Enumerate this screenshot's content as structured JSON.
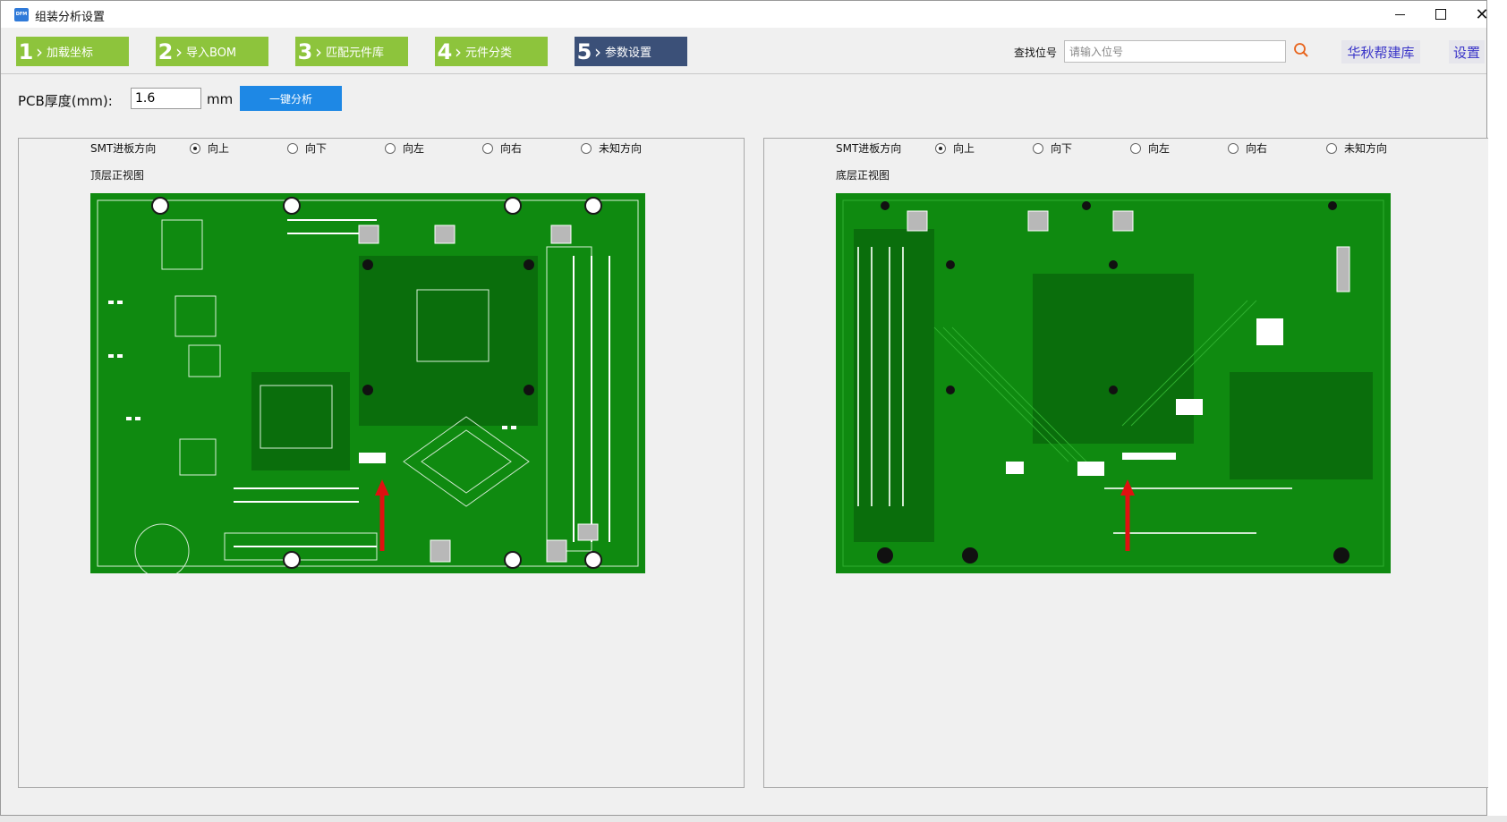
{
  "window": {
    "title": "组装分析设置",
    "app_icon_text": "DFM"
  },
  "steps": [
    {
      "num": "1",
      "label": "加载坐标",
      "state": "done"
    },
    {
      "num": "2",
      "label": "导入BOM",
      "state": "done"
    },
    {
      "num": "3",
      "label": "匹配元件库",
      "state": "done"
    },
    {
      "num": "4",
      "label": "元件分类",
      "state": "done"
    },
    {
      "num": "5",
      "label": "参数设置",
      "state": "active"
    }
  ],
  "search": {
    "label": "查找位号",
    "placeholder": "请输入位号",
    "icon": "search-icon"
  },
  "links": {
    "library": "华秋帮建库",
    "settings": "设置"
  },
  "pcb": {
    "label": "PCB厚度(mm):",
    "value": "1.6",
    "unit": "mm",
    "analyze_label": "一键分析"
  },
  "panels": [
    {
      "direction_label": "SMT进板方向",
      "options": [
        {
          "label": "向上",
          "selected": true
        },
        {
          "label": "向下",
          "selected": false
        },
        {
          "label": "向左",
          "selected": false
        },
        {
          "label": "向右",
          "selected": false
        },
        {
          "label": "未知方向",
          "selected": false
        }
      ],
      "view_label": "顶层正视图"
    },
    {
      "direction_label": "SMT进板方向",
      "options": [
        {
          "label": "向上",
          "selected": true
        },
        {
          "label": "向下",
          "selected": false
        },
        {
          "label": "向左",
          "selected": false
        },
        {
          "label": "向右",
          "selected": false
        },
        {
          "label": "未知方向",
          "selected": false
        }
      ],
      "view_label": "底层正视图"
    }
  ],
  "colors": {
    "step_done": "#8dc43c",
    "step_active": "#3b5078",
    "accent_button": "#1e88e5",
    "pcb_green": "#0f8a10",
    "pcb_dark": "#0a6e0c",
    "arrow_red": "#e01010"
  }
}
